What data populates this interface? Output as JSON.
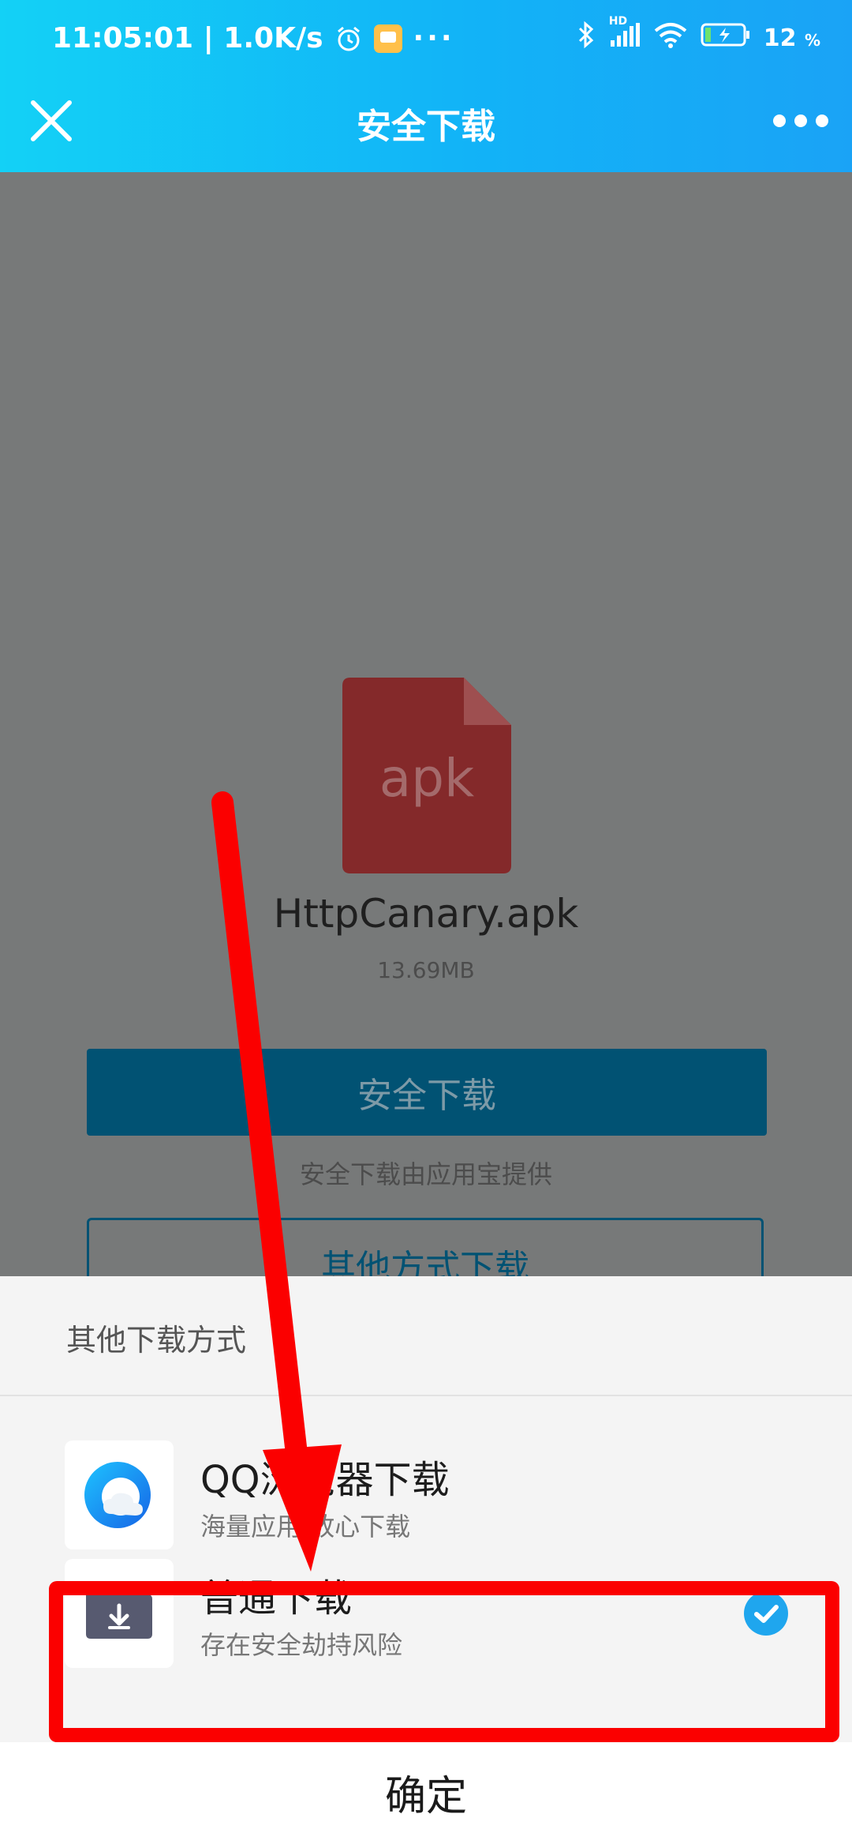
{
  "status_bar": {
    "time_speed": "11:05:01 | 1.0K/s",
    "more": "···",
    "network_hd": "HD",
    "battery": "12",
    "battery_unit": "%"
  },
  "nav": {
    "title": "安全下载"
  },
  "file": {
    "icon_label": "apk",
    "name": "HttpCanary.apk",
    "size": "13.69MB"
  },
  "main": {
    "safe_download_label": "安全下载",
    "provider_note": "安全下载由应用宝提供",
    "other_download_label": "其他方式下载"
  },
  "sheet": {
    "title": "其他下载方式",
    "options": [
      {
        "title": "QQ浏览器下载",
        "desc": "海量应用 放心下载"
      },
      {
        "title": "普通下载",
        "desc": "存在安全劫持风险",
        "selected": true
      }
    ],
    "confirm_label": "确定"
  },
  "colors": {
    "topbar_start": "#13d1f6",
    "topbar_end": "#1aa3f6",
    "dim_bg": "#777979",
    "primary_button": "#015273",
    "apk_red": "#84292a",
    "check_blue": "#1fa6ee",
    "annotation_red": "#fb0000"
  }
}
